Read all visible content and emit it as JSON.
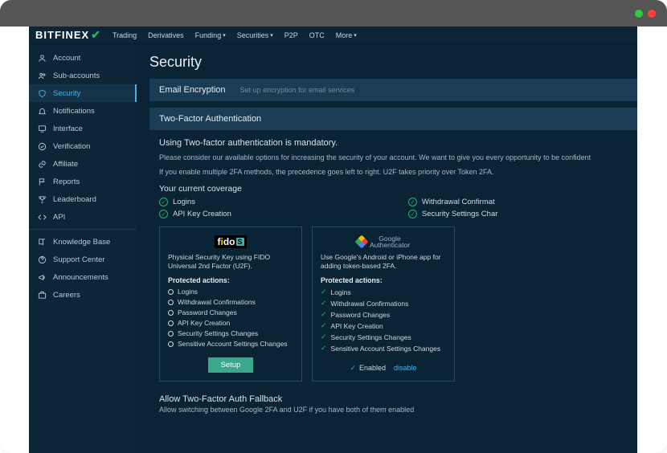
{
  "brand": "BITFINEX",
  "nav": [
    "Trading",
    "Derivatives",
    "Funding",
    "Securities",
    "P2P",
    "OTC",
    "More"
  ],
  "nav_chevron": [
    false,
    false,
    true,
    true,
    false,
    false,
    true
  ],
  "sidebar": {
    "groups": [
      [
        {
          "icon": "user",
          "label": "Account"
        },
        {
          "icon": "users",
          "label": "Sub-accounts"
        },
        {
          "icon": "shield",
          "label": "Security",
          "active": true
        },
        {
          "icon": "bell",
          "label": "Notifications"
        },
        {
          "icon": "monitor",
          "label": "Interface"
        },
        {
          "icon": "check-badge",
          "label": "Verification"
        },
        {
          "icon": "link",
          "label": "Affiliate"
        },
        {
          "icon": "flag",
          "label": "Reports"
        },
        {
          "icon": "trophy",
          "label": "Leaderboard"
        },
        {
          "icon": "code",
          "label": "API"
        }
      ],
      [
        {
          "icon": "book",
          "label": "Knowledge Base"
        },
        {
          "icon": "help",
          "label": "Support Center"
        },
        {
          "icon": "megaphone",
          "label": "Announcements"
        },
        {
          "icon": "briefcase",
          "label": "Careers"
        }
      ]
    ]
  },
  "page_title": "Security",
  "email_enc": {
    "title": "Email Encryption",
    "sub": "Set up encryption for email services"
  },
  "twofa": {
    "header": "Two-Factor Authentication",
    "mandatory": "Using Two-factor authentication is mandatory.",
    "p1": "Please consider our available options for increasing the security of your account. We want to give you every opportunity to be confident",
    "p2": "If you enable multiple 2FA methods, the precedence goes left to right. U2F takes priority over Token 2FA.",
    "cov_title": "Your current coverage",
    "cov_left": [
      "Logins",
      "API Key Creation"
    ],
    "cov_right": [
      "Withdrawal Confirmat",
      "Security Settings Char"
    ]
  },
  "fido": {
    "desc": "Physical Security Key using FIDO Universal 2nd Factor (U2F).",
    "pa_title": "Protected actions:",
    "items": [
      "Logins",
      "Withdrawal Confirmations",
      "Password Changes",
      "API Key Creation",
      "Security Settings Changes",
      "Sensitive Account Settings Changes"
    ],
    "setup": "Setup"
  },
  "google": {
    "brand1": "Google",
    "brand2": "Authenticator",
    "desc": "Use Google's Android or iPhone app for adding token-based 2FA.",
    "pa_title": "Protected actions:",
    "items": [
      "Logins",
      "Withdrawal Confirmations",
      "Password Changes",
      "API Key Creation",
      "Security Settings Changes",
      "Sensitive Account Settings Changes"
    ],
    "enabled": "Enabled",
    "disable": "disable"
  },
  "fallback": {
    "title": "Allow Two-Factor Auth Fallback",
    "sub": "Allow switching between Google 2FA and U2F if you have both of them enabled"
  }
}
